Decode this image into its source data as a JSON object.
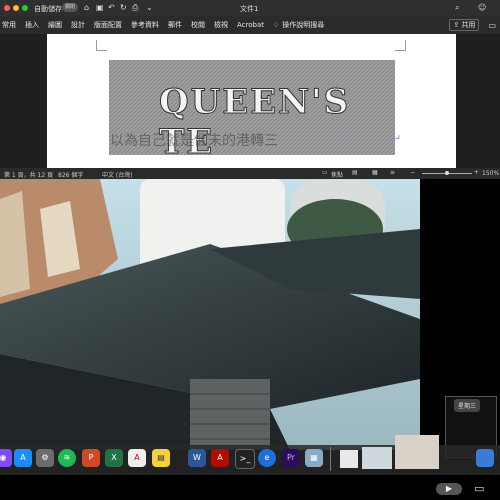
{
  "titlebar": {
    "autosave": "自動儲存",
    "toggle": "關閉",
    "title": "文件1"
  },
  "ribbon": {
    "tabs": [
      "常用",
      "插入",
      "繪圖",
      "設計",
      "版面配置",
      "參考資料",
      "郵件",
      "校閱",
      "檢視",
      "Acrobat"
    ],
    "search": "操作說明搜尋",
    "share": "共用"
  },
  "document": {
    "image_text": "QUEEN'S TE",
    "line_text": "以為自己就是個未的港轉三",
    "cursor_mark": "↵"
  },
  "statusbar": {
    "page": "第 1 頁，共 12 頁",
    "words": "826 個字",
    "language": "中文 (台灣)",
    "focus": "焦點",
    "zoom": "150%"
  },
  "dock": {
    "tooltip": "星期三",
    "apps": [
      "Siri",
      "App Store",
      "System Preferences",
      "Spotify",
      "PowerPoint",
      "Excel",
      "Acrobat Reader",
      "Stickies",
      "Word",
      "Acrobat",
      "Terminal",
      "Edge",
      "Premiere Pro",
      "Preview"
    ]
  },
  "colors": {
    "spotify": "#1db954",
    "word": "#2b579a",
    "excel": "#217346",
    "powerpoint": "#d24726",
    "premiere": "#2a0e5a",
    "acrobat": "#b30b00"
  }
}
